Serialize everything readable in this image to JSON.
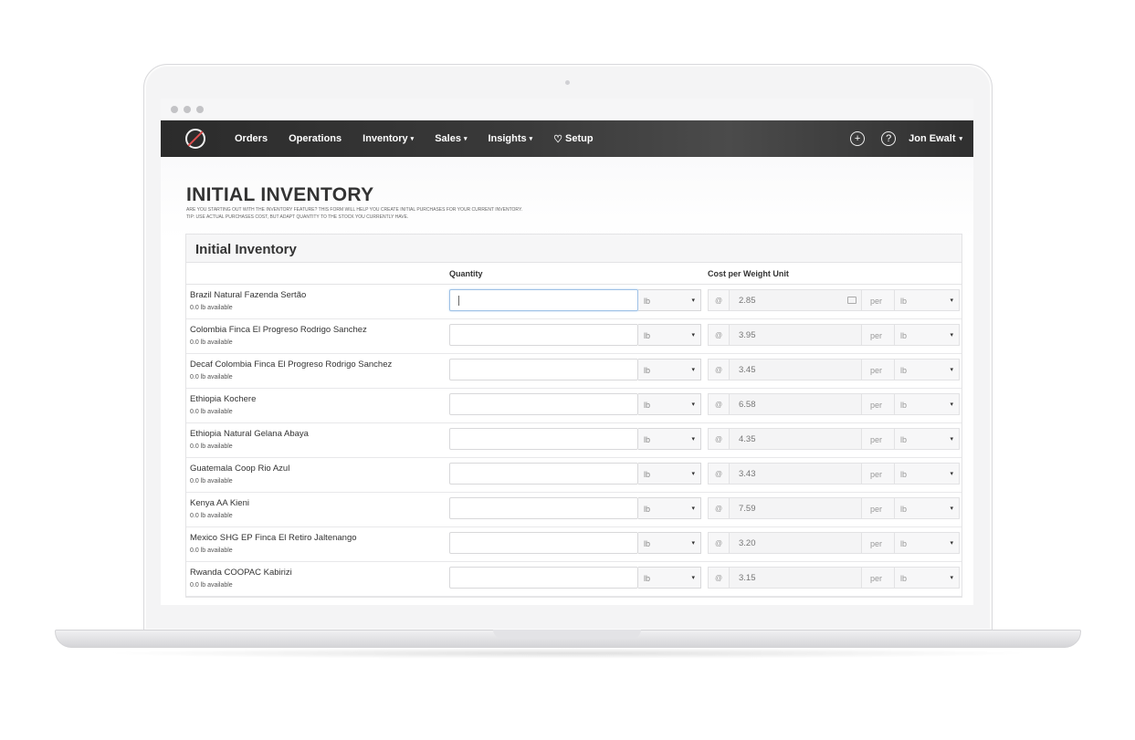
{
  "nav": {
    "items": [
      {
        "label": "Orders",
        "caret": ""
      },
      {
        "label": "Operations",
        "caret": ""
      },
      {
        "label": "Inventory",
        "caret": "▾"
      },
      {
        "label": "Sales",
        "caret": "▾"
      },
      {
        "label": "Insights",
        "caret": "▾"
      },
      {
        "label": "Setup",
        "caret": ""
      }
    ],
    "user": "Jon Ewalt",
    "user_caret": "▾",
    "add_icon": "+",
    "help_icon": "?",
    "setup_icon": "🏆",
    "logo_icon": "no-coffee-logo"
  },
  "page": {
    "title": "INITIAL INVENTORY",
    "subtitle_1": "ARE YOU STARTING OUT WITH THE INVENTORY FEATURE? THIS FORM WILL HELP YOU CREATE INITIAL PURCHASES FOR YOUR CURRENT INVENTORY.",
    "subtitle_2": "TIP: USE ACTUAL PURCHASES COST, BUT ADAPT QUANTITY TO THE STOCK YOU CURRENTLY HAVE."
  },
  "panel": {
    "title": "Initial Inventory",
    "col_quantity": "Quantity",
    "col_cost": "Cost per Weight Unit"
  },
  "labels": {
    "at": "@",
    "per": "per",
    "unit": "lb",
    "caret": "▾"
  },
  "rows": [
    {
      "name": "Brazil Natural Fazenda Sertão",
      "available": "0.0 lb available",
      "cost": "2.85"
    },
    {
      "name": "Colombia Finca El Progreso Rodrigo Sanchez",
      "available": "0.0 lb available",
      "cost": "3.95"
    },
    {
      "name": "Decaf Colombia Finca El Progreso Rodrigo Sanchez",
      "available": "0.0 lb available",
      "cost": "3.45"
    },
    {
      "name": "Ethiopia Kochere",
      "available": "0.0 lb available",
      "cost": "6.58"
    },
    {
      "name": "Ethiopia Natural Gelana Abaya",
      "available": "0.0 lb available",
      "cost": "4.35"
    },
    {
      "name": "Guatemala Coop Rio Azul",
      "available": "0.0 lb available",
      "cost": "3.43"
    },
    {
      "name": "Kenya AA Kieni",
      "available": "0.0 lb available",
      "cost": "7.59"
    },
    {
      "name": "Mexico SHG EP Finca El Retiro Jaltenango",
      "available": "0.0 lb available",
      "cost": "3.20"
    },
    {
      "name": "Rwanda COOPAC Kabirizi",
      "available": "0.0 lb available",
      "cost": "3.15"
    }
  ]
}
